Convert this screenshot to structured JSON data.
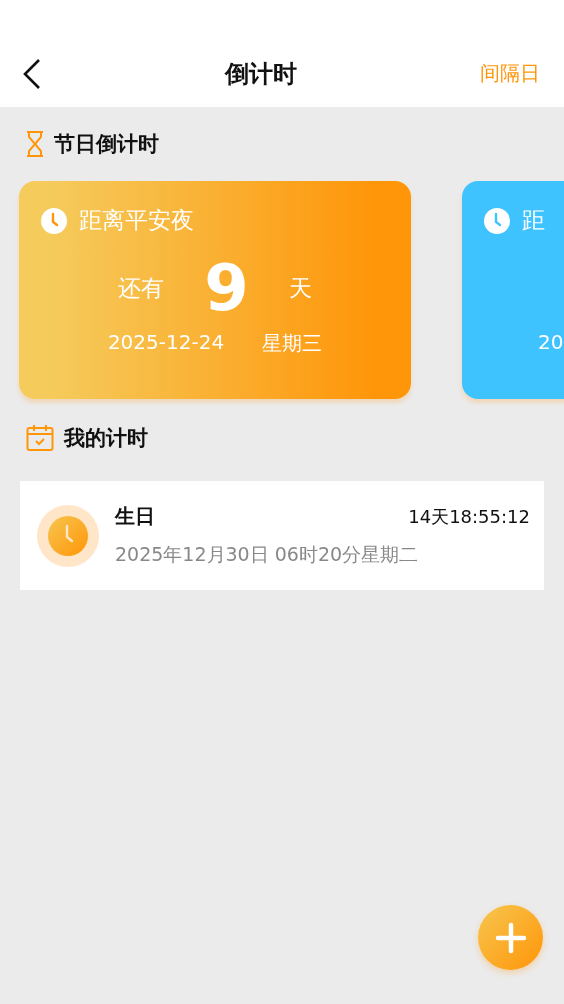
{
  "header": {
    "title": "倒计时",
    "action": "间隔日"
  },
  "holiday_section": {
    "title": "节日倒计时"
  },
  "holiday_cards": [
    {
      "title": "距离平安夜",
      "prefix": "还有",
      "days": "9",
      "unit": "天",
      "date": "2025-12-24",
      "weekday": "星期三",
      "color": "#ff9508"
    },
    {
      "title": "距",
      "date": "20",
      "color": "#3ec3ff"
    }
  ],
  "my_section": {
    "title": "我的计时"
  },
  "timers": [
    {
      "name": "生日",
      "remaining": "14天18:55:12",
      "datetime": "2025年12月30日 06时20分星期二"
    }
  ]
}
